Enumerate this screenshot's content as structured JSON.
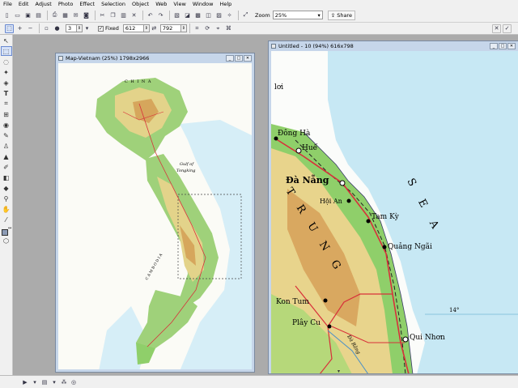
{
  "menu": [
    "File",
    "Edit",
    "Adjust",
    "Photo",
    "Effect",
    "Selection",
    "Object",
    "Web",
    "View",
    "Window",
    "Help"
  ],
  "toolbar": {
    "zoom_label": "Zoom",
    "zoom_value": "25%",
    "share_label": "Share"
  },
  "options_bar": {
    "brush_size": "3",
    "fixed_label": "Fixed",
    "width": "612",
    "height": "792"
  },
  "windows": {
    "map_title": "Map-Vietnam (25%) 1798x2966",
    "crop_title": "Untitled - 10 (94%) 616x798"
  },
  "map_labels": {
    "china": "C H I N A",
    "gulf": "Gulf of",
    "tongking": "Tongking",
    "cambodia": "C A M B O D I A"
  },
  "crop_labels": {
    "top_cut": "lơi",
    "dong_ha": "Đông Hà",
    "hue": "Huế",
    "da_nang": "Đà Nẵng",
    "hoi_an": "Hội An",
    "tam_ky": "Tam Kỳ",
    "quang_ngai": "Quảng Ngãi",
    "kon_tum": "Kon Tum",
    "play_cu": "Plây Cu",
    "qui_nhon": "Qui Nhơn",
    "trung": "T R U N G",
    "sea": "S E A",
    "lat": "14°",
    "river": "Đà Rằng"
  },
  "colors": {
    "ui_bg": "#f0f0f0",
    "workspace": "#ababab",
    "window_frame": "#c6d6ea",
    "sea": "#c7e8f4",
    "lowland": "#8fcf6a",
    "upland": "#e8d48c",
    "highland": "#d9a860",
    "road": "#d8303a"
  }
}
